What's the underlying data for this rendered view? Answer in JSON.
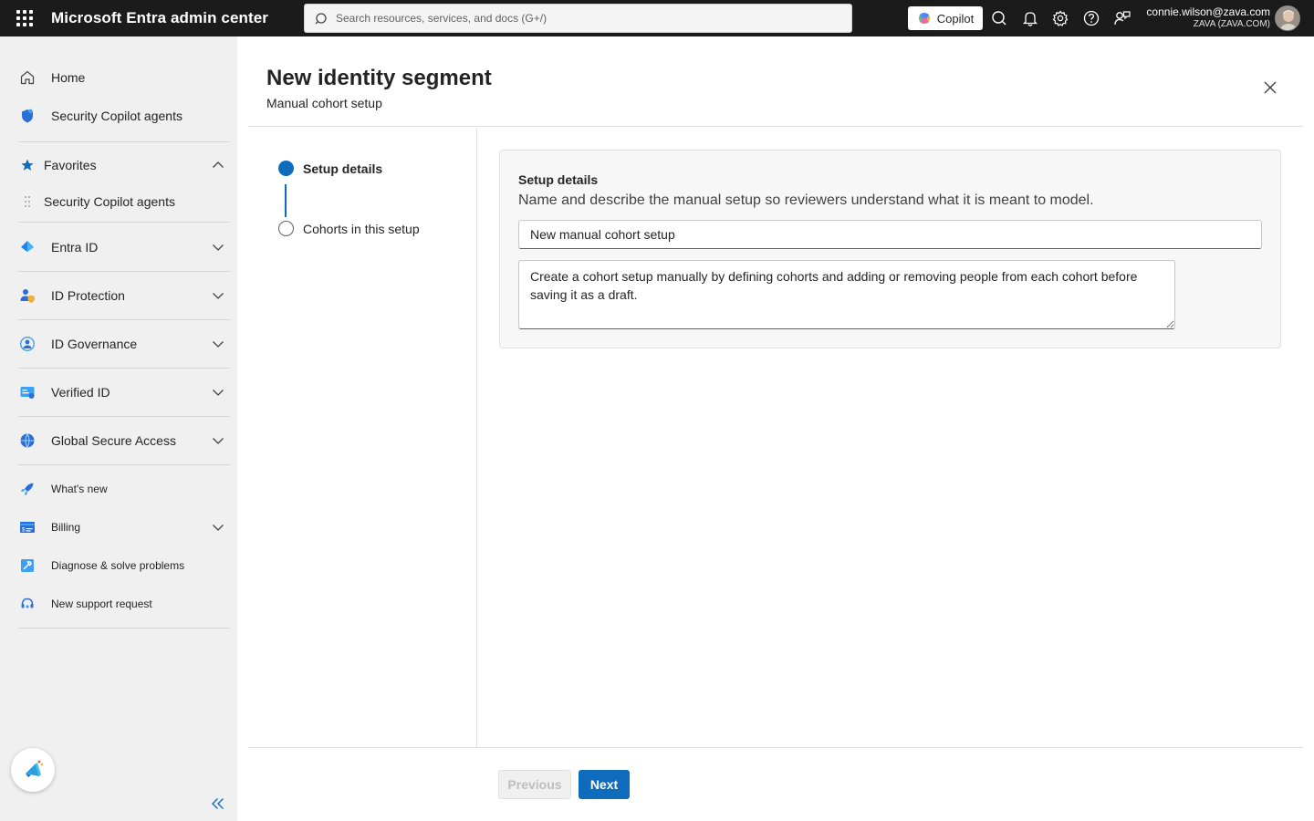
{
  "topbar": {
    "app_title": "Microsoft Entra admin center",
    "search_placeholder": "Search resources, services, and docs (G+/)",
    "copilot_label": "Copilot",
    "user_email": "connie.wilson@zava.com",
    "tenant": "ZAVA (ZAVA.COM)",
    "icons": [
      "search-icon",
      "bell-icon",
      "gear-icon",
      "help-icon",
      "feedback-icon"
    ]
  },
  "sidebar": {
    "home": "Home",
    "security_copilot": "Security Copilot agents",
    "favorites": "Favorites",
    "favorites_items": [
      "Security Copilot agents"
    ],
    "entra_id": "Entra ID",
    "id_protection": "ID Protection",
    "id_governance": "ID Governance",
    "verified_id": "Verified ID",
    "global_secure_access": "Global Secure Access",
    "whats_new": "What's new",
    "billing": "Billing",
    "diagnose": "Diagnose & solve problems",
    "support": "New support request"
  },
  "page": {
    "title": "New identity segment",
    "subtitle": "Manual cohort setup"
  },
  "wizard": {
    "steps": [
      {
        "label": "Setup details",
        "state": "active"
      },
      {
        "label": "Cohorts in this setup",
        "state": "inactive"
      }
    ]
  },
  "form": {
    "section_title": "Setup details",
    "section_description": "Name and describe the manual setup so reviewers understand what it is meant to model.",
    "name_value": "New manual cohort setup",
    "description_value": "Create a cohort setup manually by defining cohorts and adding or removing people from each cohort before saving it as a draft."
  },
  "footer": {
    "previous_label": "Previous",
    "next_label": "Next"
  },
  "colors": {
    "accent": "#0f6cbd",
    "topbar": "#1b1b1b",
    "sidebar": "#f0f0f0"
  }
}
